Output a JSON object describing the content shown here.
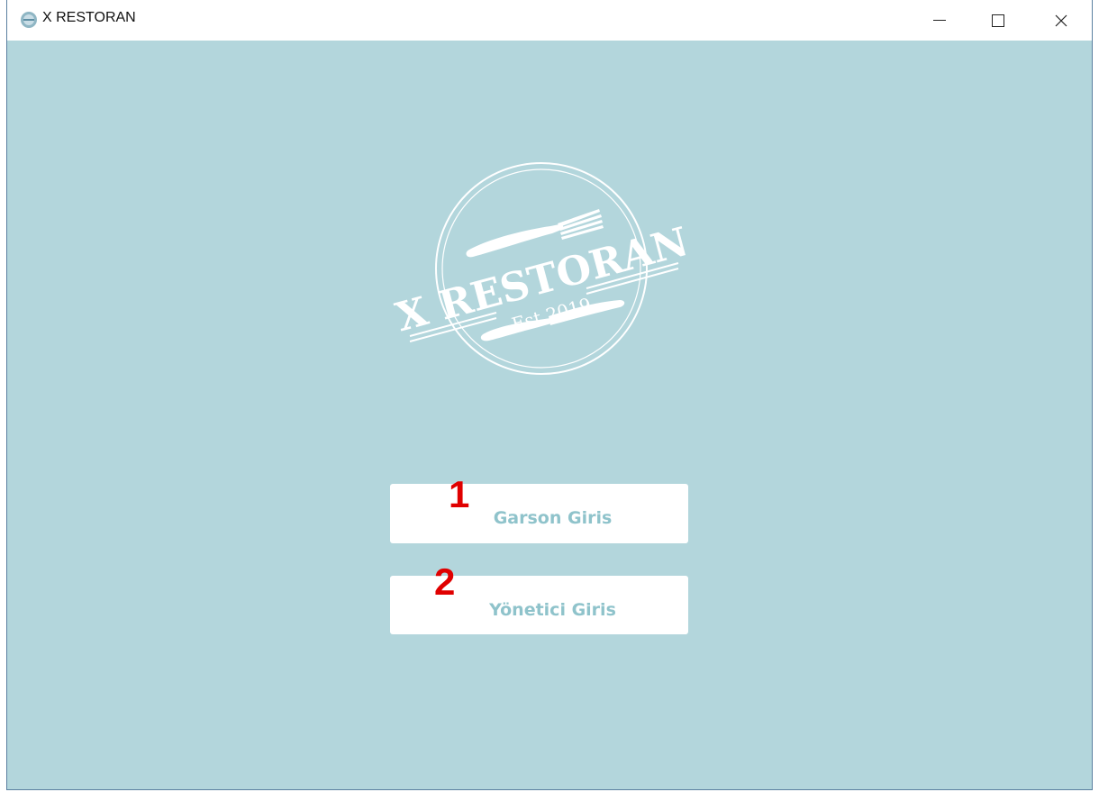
{
  "window": {
    "title": "X RESTORAN",
    "icon": "restaurant-app-icon",
    "controls": {
      "minimize": "minimize-icon",
      "maximize": "maximize-icon",
      "close": "✕"
    }
  },
  "logo": {
    "name": "X RESTORAN",
    "tagline": "Est 2019"
  },
  "buttons": {
    "garson": {
      "label": "Garson Giris",
      "badge": "1"
    },
    "yonetici": {
      "label": "Yönetici Giris",
      "badge": "2"
    }
  },
  "colors": {
    "background": "#b3d6dc",
    "button_text": "#8fc3cb",
    "badge": "#e00000",
    "logo": "#ffffff"
  }
}
